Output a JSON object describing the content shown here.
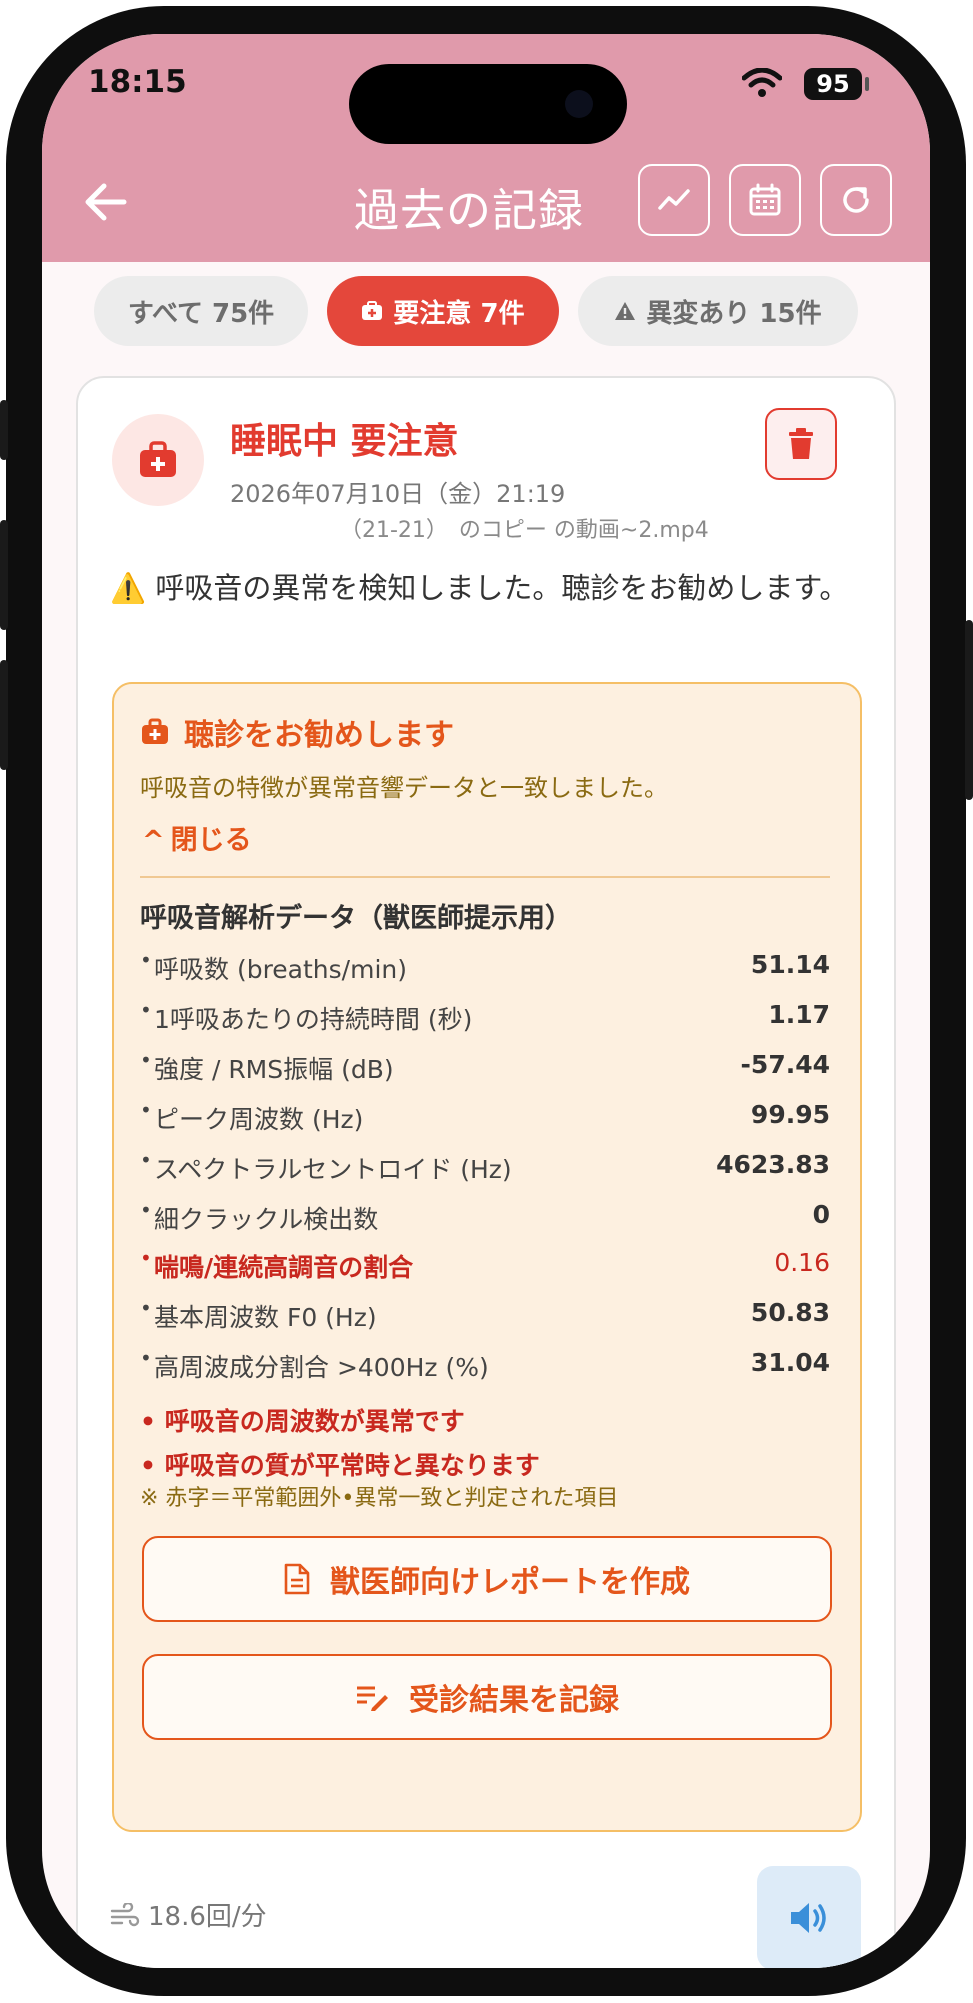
{
  "status_bar": {
    "time": "18:15",
    "battery": "95"
  },
  "header": {
    "title": "過去の記録"
  },
  "filters": [
    {
      "label": "すべて 75件",
      "active": false
    },
    {
      "label": "要注意 7件",
      "active": true
    },
    {
      "label": "異変あり 15件",
      "active": false
    }
  ],
  "record": {
    "title": "睡眠中 要注意",
    "datetime": "2026年07月10日（金）21:19",
    "filename": "（21-21）　のコピー の動画~2.mp4",
    "message": "⚠️ 呼吸音の異常を検知しました。聴診をお勧めします。",
    "respiration": "18.6回/分"
  },
  "alert": {
    "title": "聴診をお勧めします",
    "subtitle": "呼吸音の特徴が異常音響データと一致しました。",
    "close_label": "閉じる",
    "section_title": "呼吸音解析データ（獣医師提示用）",
    "metrics": [
      {
        "label": "呼吸数 (breaths/min)",
        "value": "51.14"
      },
      {
        "label": "1呼吸あたりの持続時間 (秒)",
        "value": "1.17"
      },
      {
        "label": "強度 / RMS振幅 (dB)",
        "value": "-57.44"
      },
      {
        "label": "ピーク周波数 (Hz)",
        "value": "99.95"
      },
      {
        "label": "スペクトラルセントロイド (Hz)",
        "value": "4623.83"
      },
      {
        "label": "細クラックル検出数",
        "value": "0"
      },
      {
        "label": "喘鳴/連続高調音の割合",
        "value": "0.16"
      },
      {
        "label": "基本周波数 F0 (Hz)",
        "value": "50.83"
      },
      {
        "label": "高周波成分割合 >400Hz (%)",
        "value": "31.04"
      }
    ],
    "findings": [
      "呼吸音の周波数が異常です",
      "呼吸音の質が平常時と異なります"
    ],
    "legend": "※ 赤字＝平常範囲外•異常一致と判定された項目",
    "report_button": "獣医師向けレポートを作成",
    "record_button": "受診結果を記録"
  },
  "colors": {
    "header": "#e09aab",
    "danger": "#e23b2f",
    "accent_orange": "#e4561b",
    "alert_bg": "#fdf0e0"
  }
}
